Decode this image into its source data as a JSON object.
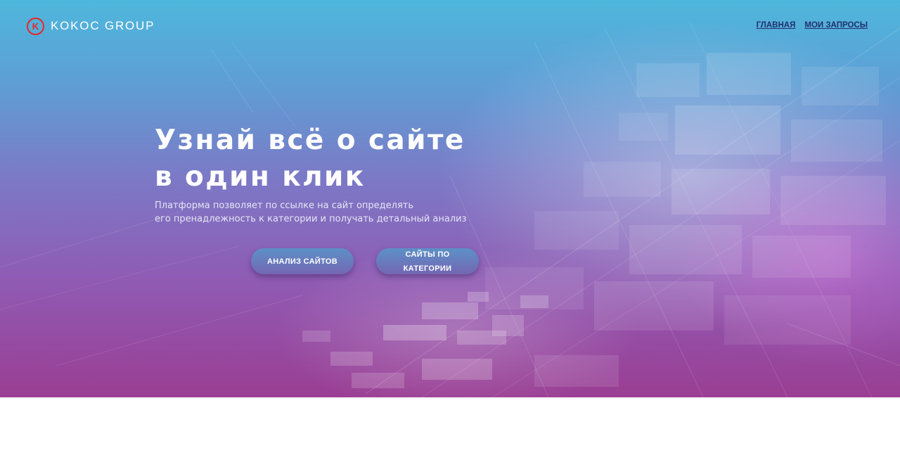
{
  "brand": {
    "name": "KOKOC GROUP",
    "mark": "K",
    "mark_color": "#e8262b"
  },
  "nav": {
    "items": [
      {
        "label": "ГЛАВНАЯ"
      },
      {
        "label": "МОИ ЗАПРОСЫ"
      }
    ]
  },
  "hero": {
    "headline": "Узнай всё о сайте\nв один клик",
    "subtitle": "Платформа позволяет по ссылке на сайт определять\nего пренадлежность к категории и получать детальный анализ",
    "buttons": {
      "analysis": "АНАЛИЗ САЙТОВ",
      "categories": "САЙТЫ ПО КАТЕГОРИИ"
    }
  },
  "colors": {
    "gradient_top": "#4eb7dc",
    "gradient_bottom": "#9a3e93",
    "nav_link": "#21306c",
    "page_background": "#ffffff"
  }
}
